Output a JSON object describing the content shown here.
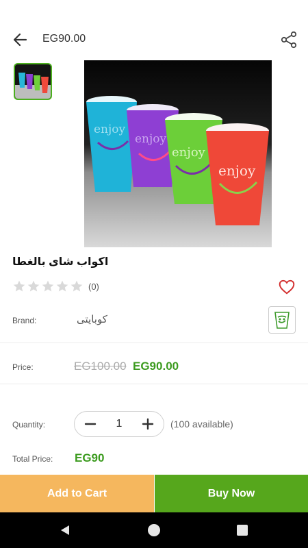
{
  "header": {
    "price": "EG90.00"
  },
  "product": {
    "title": "اكواب شاى بالغطا",
    "image_text": "enjoy",
    "rating": {
      "stars": 0,
      "max": 5,
      "count_label": "(0)"
    },
    "brand_label": "Brand:",
    "brand_value": "كوبايتى"
  },
  "pricing": {
    "label": "Price:",
    "old_price": "EG100.00",
    "new_price": "EG90.00"
  },
  "quantity": {
    "label": "Quantity:",
    "value": "1",
    "available": "(100 available)"
  },
  "total": {
    "label": "Total Price:",
    "value": "EG90"
  },
  "actions": {
    "add_to_cart": "Add to Cart",
    "buy_now": "Buy Now"
  },
  "colors": {
    "green": "#56a71c",
    "price_green": "#3c9b1f",
    "orange": "#f5b75e",
    "heart": "#d32f2f"
  }
}
